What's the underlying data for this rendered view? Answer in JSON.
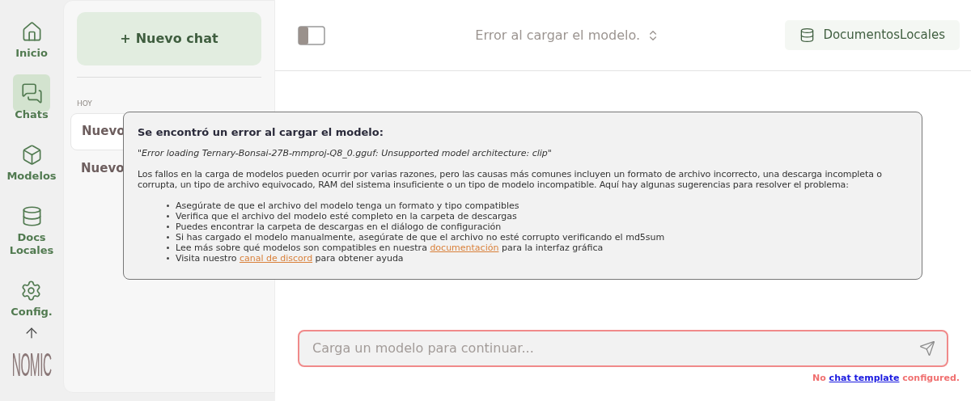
{
  "nav": [
    {
      "kind": "home",
      "label": "Inicio",
      "selected": false
    },
    {
      "kind": "chats",
      "label": "Chats",
      "selected": true
    },
    {
      "kind": "models",
      "label": "Modelos",
      "selected": false
    },
    {
      "kind": "docs",
      "label": "Docs Locales",
      "selected": false
    },
    {
      "kind": "settings",
      "label": "Config.",
      "selected": false
    }
  ],
  "logo": "NOMIC",
  "new_chat": {
    "icon": "+",
    "label": "Nuevo chat"
  },
  "chat_group": "HOY",
  "chats": [
    {
      "title": "Nuevo",
      "selected": true
    },
    {
      "title": "Nuevo",
      "selected": false
    }
  ],
  "header": {
    "model": "Error al cargar el modelo.",
    "localdocs": "DocumentosLocales"
  },
  "dialog": {
    "title": "Se encontró un error al cargar el modelo:",
    "error": "\"Error loading Ternary-Bonsai-27B-mmproj-Q8_0.gguf: Unsupported model architecture: clip\"",
    "body": "Los fallos en la carga de modelos pueden ocurrir por varias razones, pero las causas más comunes incluyen un formato de archivo incorrecto, una descarga incompleta o corrupta, un tipo de archivo equivocado, RAM del sistema insuficiente o un tipo de modelo incompatible. Aquí hay algunas sugerencias para resolver el problema:",
    "tips": [
      [
        {
          "kind": "text",
          "text": "Asegúrate de que el archivo del modelo tenga un formato y tipo compatibles"
        }
      ],
      [
        {
          "kind": "text",
          "text": "Verifica que el archivo del modelo esté completo en la carpeta de descargas"
        }
      ],
      [
        {
          "kind": "text",
          "text": "Puedes encontrar la carpeta de descargas en el diálogo de configuración"
        }
      ],
      [
        {
          "kind": "text",
          "text": "Si has cargado el modelo manualmente, asegúrate de que el archivo no esté corrupto verificando el md5sum"
        }
      ],
      [
        {
          "kind": "text",
          "text": "Lee más sobre qué modelos son compatibles en nuestra "
        },
        {
          "kind": "link",
          "text": "documentación"
        },
        {
          "kind": "text",
          "text": " para la interfaz gráfica"
        }
      ],
      [
        {
          "kind": "text",
          "text": "Visita nuestro "
        },
        {
          "kind": "link",
          "text": "canal de discord"
        },
        {
          "kind": "text",
          "text": " para obtener ayuda"
        }
      ]
    ]
  },
  "input": {
    "placeholder": "Carga un modelo para continuar..."
  },
  "footer": [
    {
      "kind": "text",
      "text": "No "
    },
    {
      "kind": "link",
      "text": "chat template"
    },
    {
      "kind": "text",
      "text": " configured."
    }
  ]
}
